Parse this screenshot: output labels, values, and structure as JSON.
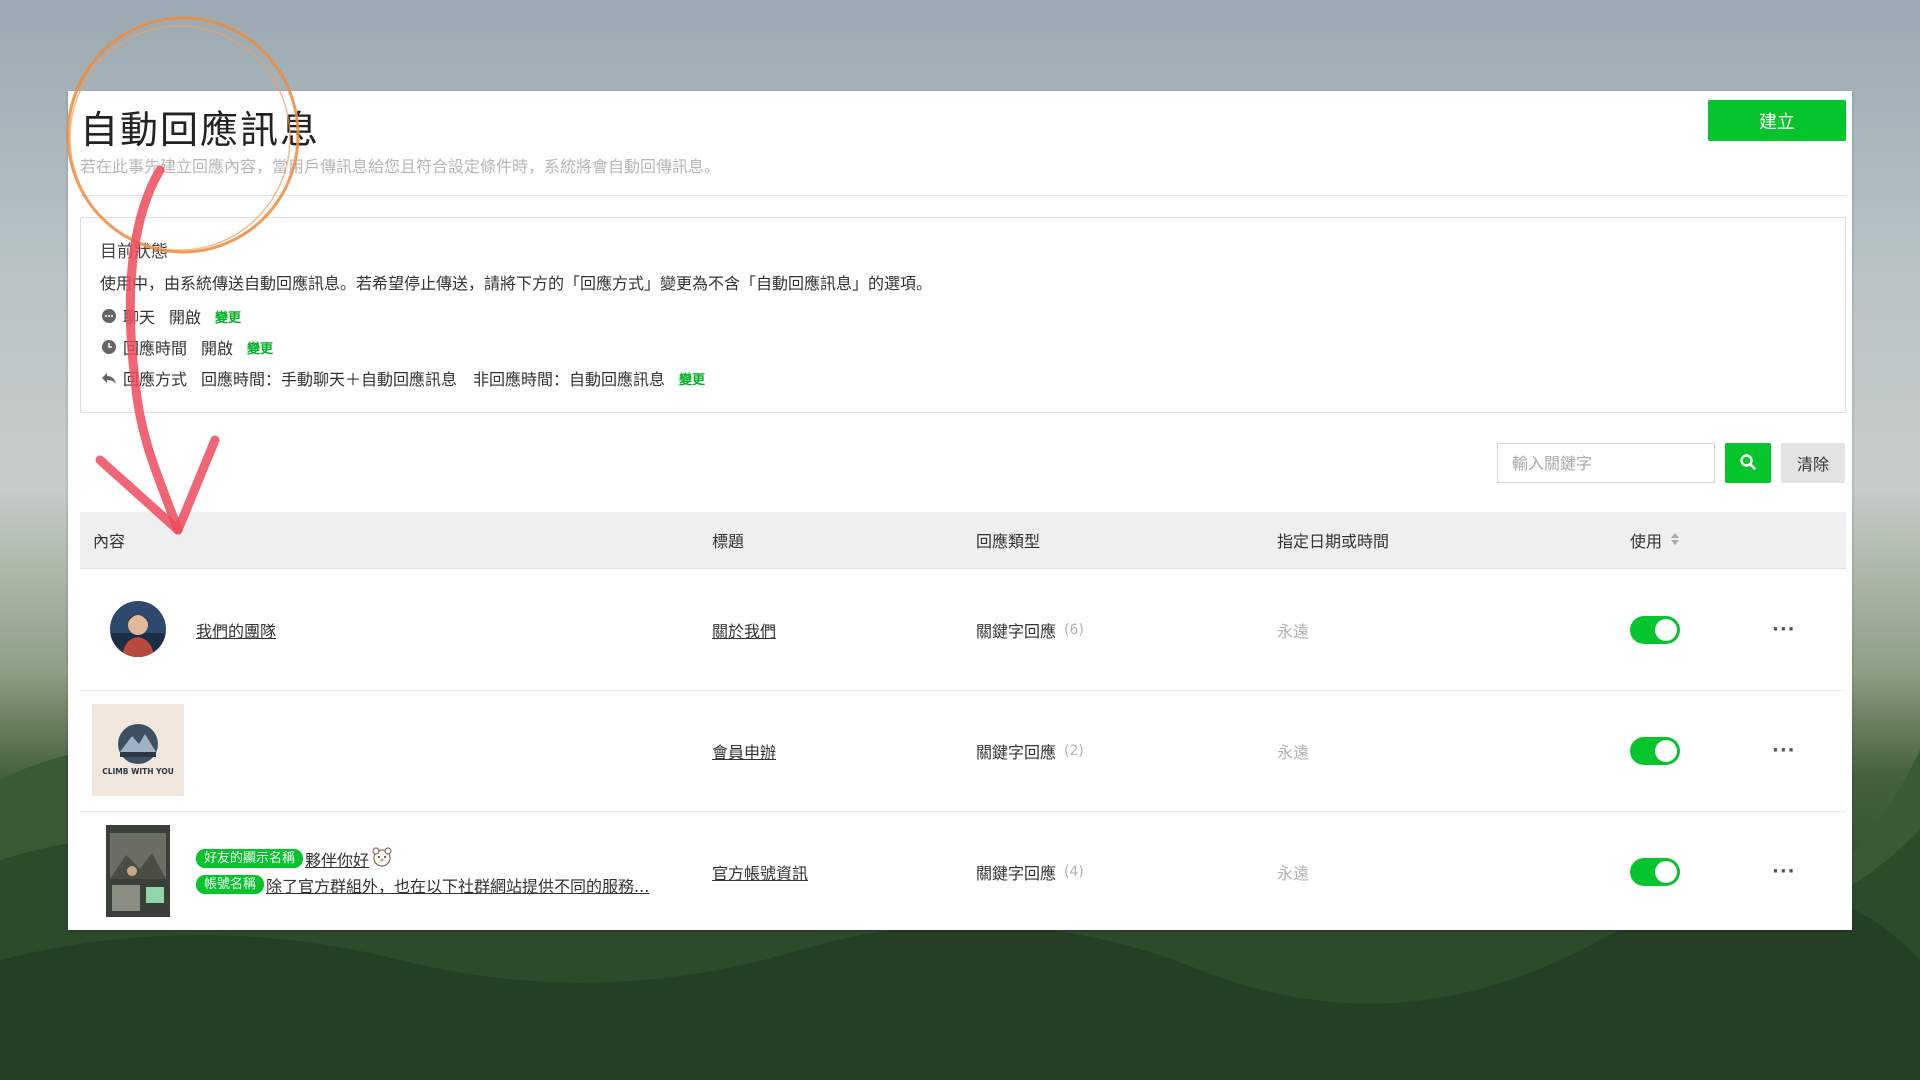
{
  "header": {
    "title": "自動回應訊息",
    "subtitle": "若在此事先建立回應內容，當用戶傳訊息給您且符合設定條件時，系統將會自動回傳訊息。",
    "create_label": "建立"
  },
  "status": {
    "title": "目前狀態",
    "description": "使用中，由系統傳送自動回應訊息。若希望停止傳送，請將下方的「回應方式」變更為不含「自動回應訊息」的選項。",
    "rows": [
      {
        "icon": "chat-bubble-icon",
        "label": "聊天",
        "value": "開啟",
        "change": "變更"
      },
      {
        "icon": "clock-icon",
        "label": "回應時間",
        "value": "開啟",
        "change": "變更"
      },
      {
        "icon": "reply-arrow-icon",
        "label": "回應方式",
        "value": "回應時間：手動聊天＋自動回應訊息　非回應時間：自動回應訊息",
        "change": "變更"
      }
    ]
  },
  "search": {
    "placeholder": "輸入關鍵字",
    "clear_label": "清除"
  },
  "table": {
    "columns": [
      "內容",
      "標題",
      "回應類型",
      "指定日期或時間",
      "使用"
    ],
    "rows": [
      {
        "content_text": "我們的團隊",
        "title": "關於我們",
        "type": "關鍵字回應",
        "count": "(6)",
        "schedule": "永遠",
        "enabled": true
      },
      {
        "content_text": "",
        "image_caption": "CLIMB WITH YOU",
        "title": "會員申辦",
        "type": "關鍵字回應",
        "count": "(2)",
        "schedule": "永遠",
        "enabled": true
      },
      {
        "tag1": "好友的顯示名稱",
        "line1": "夥伴你好",
        "tag2": "帳號名稱",
        "line2": "除了官方群組外，也在以下社群網站提供不同的服務...",
        "title": "官方帳號資訊",
        "type": "關鍵字回應",
        "count": "(4)",
        "schedule": "永遠",
        "enabled": true
      }
    ]
  },
  "colors": {
    "accent": "#06c42c",
    "annotation_orange": "#f08a3a",
    "annotation_red": "#ee4a5c"
  }
}
